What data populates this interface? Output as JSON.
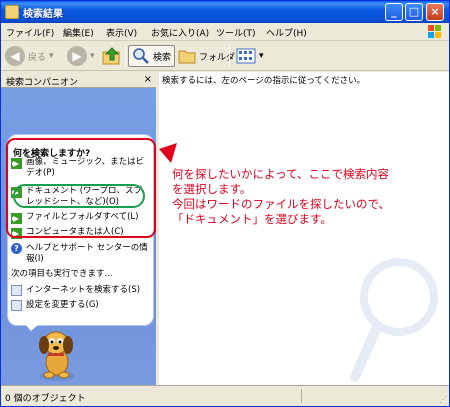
{
  "window": {
    "title": "検索結果"
  },
  "menubar": {
    "items": [
      "ファイル(F)",
      "編集(E)",
      "表示(V)",
      "お気に入り(A)",
      "ツール(T)",
      "ヘルプ(H)"
    ]
  },
  "toolbar": {
    "back_label": "戻る",
    "search_label": "検索",
    "folder_label": "フォルダ"
  },
  "left_pane": {
    "header": "検索コンパニオン",
    "question": "何を検索しますか?",
    "options": [
      "画像、ミュージック、またはビデオ(P)",
      "ドキュメント (ワープロ、スプレッドシート、など)(O)",
      "ファイルとフォルダすべて(L)",
      "コンピュータまたは人(C)"
    ],
    "help_link": "ヘルプとサポート センターの情報(I)",
    "also_label": "次の項目も実行できます...",
    "extra_links": [
      "インターネットを検索する(S)",
      "設定を変更する(G)"
    ]
  },
  "right_pane": {
    "instruction": "検索するには、左のページの指示に従ってください。"
  },
  "annotation": {
    "lines": [
      "何を探したいかによって、ここで検索内容",
      "を選択します。",
      "今回はワードのファイルを探したいので、",
      "「ドキュメント」を選びます。"
    ]
  },
  "statusbar": {
    "text": "0 個のオブジェクト"
  },
  "colors": {
    "title_blue": "#0a52d8",
    "annotation_red": "#e0001c",
    "highlight_green": "#16a04a",
    "pane_blue": "#7aa1e6"
  }
}
